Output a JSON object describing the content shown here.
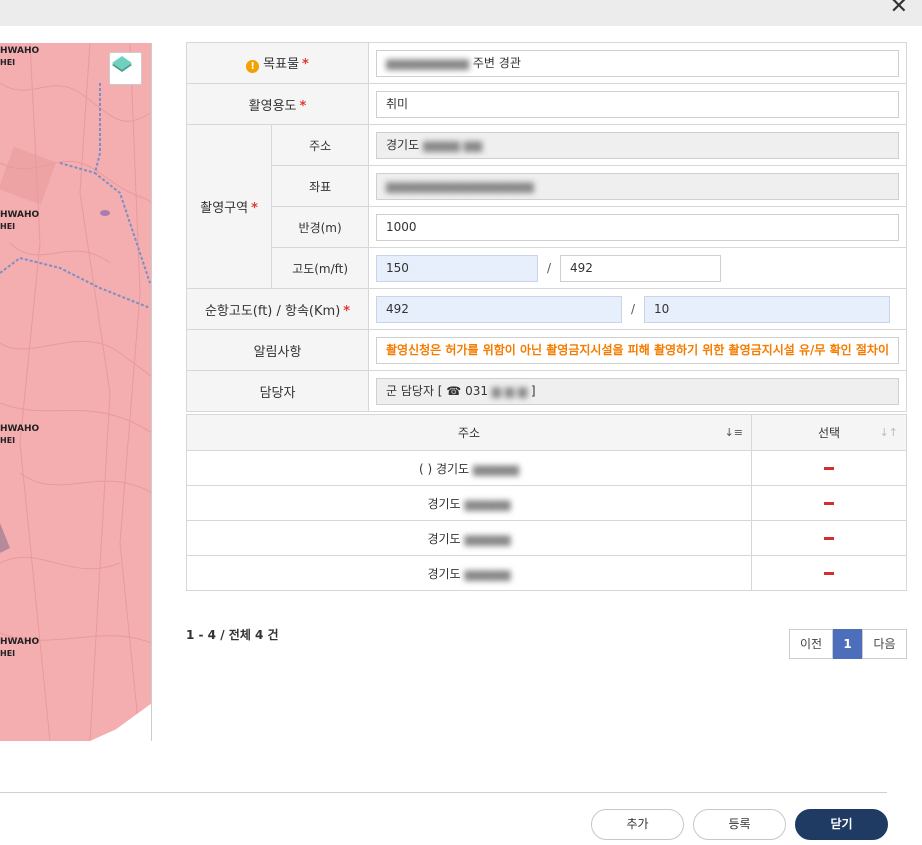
{
  "window": {
    "close_glyph": "✕"
  },
  "map": {
    "labels": [
      "HWAHO",
      "HEI",
      "HWAHO",
      "HEI",
      "HWAHO",
      "HEI",
      "HWAHO",
      "HEI"
    ],
    "layer_icon": "layers-icon"
  },
  "form": {
    "target": {
      "label": "목표물",
      "value": "주변 경관"
    },
    "purpose": {
      "label": "활영용도",
      "value": "취미"
    },
    "area": {
      "label": "촬영구역",
      "address": {
        "label": "주소",
        "value": "경기도"
      },
      "coords": {
        "label": "좌표",
        "value": ""
      },
      "radius": {
        "label": "반경(m)",
        "value": "1000"
      },
      "altitude": {
        "label": "고도(m/ft)",
        "value_m": "150",
        "value_ft": "492",
        "separator": "/"
      }
    },
    "cruise": {
      "label": "순항고도(ft) / 항속(Km)",
      "altitude": "492",
      "range": "10",
      "separator": "/"
    },
    "notice": {
      "label": "알림사항",
      "value": "촬영신청은 허가를 위함이 아닌 촬영금지시설을 피해 촬영하기 위한 촬영금지시설 유/무 확인 절차이"
    },
    "manager": {
      "label": "담당자",
      "value": "군 담당자 [ ☎ 031",
      "close_bracket": "]"
    },
    "required_mark": "*"
  },
  "list": {
    "headers": {
      "address": "주소",
      "select": "선택"
    },
    "rows": [
      {
        "address": "(  ) 경기도"
      },
      {
        "address": "경기도"
      },
      {
        "address": "경기도"
      },
      {
        "address": "경기도"
      }
    ]
  },
  "pagination": {
    "summary": "1 - 4 / 전체 4 건",
    "prev": "이전",
    "current": "1",
    "next": "다음"
  },
  "buttons": {
    "add": "추가",
    "register": "등록",
    "close": "닫기"
  },
  "colors": {
    "primary": "#1f3b63",
    "page_active": "#4c6ebb",
    "warning": "#f57c00",
    "required": "#e53935",
    "map_fill": "#f4aeb0"
  }
}
